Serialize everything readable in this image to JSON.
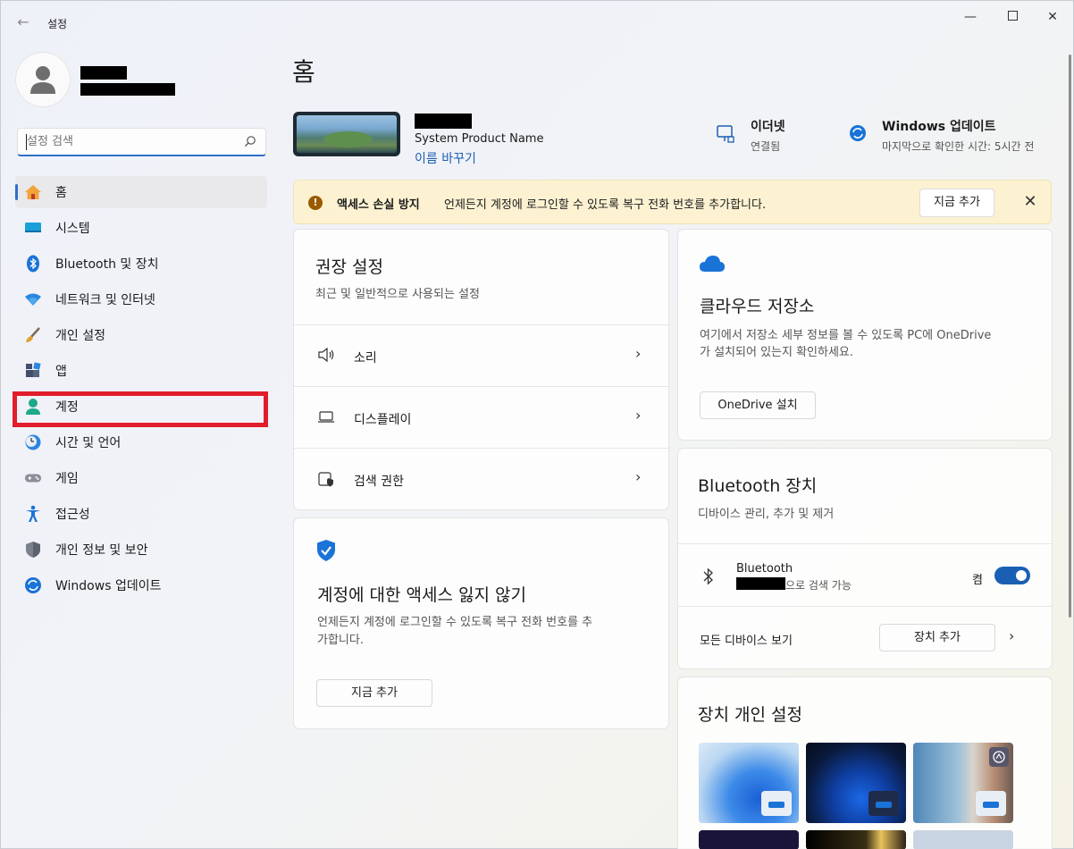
{
  "titlebar": {
    "app_title": "설정"
  },
  "search": {
    "placeholder": "설정 검색"
  },
  "nav": [
    {
      "label": "홈",
      "icon": "home-icon"
    },
    {
      "label": "시스템",
      "icon": "system-icon"
    },
    {
      "label": "Bluetooth 및 장치",
      "icon": "bluetooth-icon"
    },
    {
      "label": "네트워크 및 인터넷",
      "icon": "wifi-icon"
    },
    {
      "label": "개인 설정",
      "icon": "brush-icon"
    },
    {
      "label": "앱",
      "icon": "apps-icon"
    },
    {
      "label": "계정",
      "icon": "account-icon"
    },
    {
      "label": "시간 및 언어",
      "icon": "clock-globe-icon"
    },
    {
      "label": "게임",
      "icon": "gamepad-icon"
    },
    {
      "label": "접근성",
      "icon": "accessibility-icon"
    },
    {
      "label": "개인 정보 및 보안",
      "icon": "shield-icon"
    },
    {
      "label": "Windows 업데이트",
      "icon": "update-icon"
    }
  ],
  "main": {
    "title": "홈",
    "device": {
      "model": "System Product Name",
      "rename": "이름 바꾸기"
    },
    "status": [
      {
        "title": "이더넷",
        "sub": "연결됨"
      },
      {
        "title": "Windows 업데이트",
        "sub": "마지막으로 확인한 시간: 5시간 전"
      }
    ],
    "banner": {
      "title": "액세스 손실 방지",
      "text": "언제든지 계정에 로그인할 수 있도록 복구 전화 번호를 추가합니다.",
      "button": "지금 추가"
    },
    "recommended": {
      "title": "권장 설정",
      "sub": "최근 및 일반적으로 사용되는 설정",
      "items": [
        "소리",
        "디스플레이",
        "검색 권한"
      ]
    },
    "account_card": {
      "title": "계정에 대한 액세스 잃지 않기",
      "text_line1": "언제든지 계정에 로그인할 수 있도록 복구 전화 번호를 추",
      "text_line2": "가합니다.",
      "button": "지금 추가"
    },
    "cloud_card": {
      "title": "클라우드 저장소",
      "text_line1": "여기에서 저장소 세부 정보를 볼 수 있도록 PC에 OneDrive",
      "text_line2": "가 설치되어 있는지 확인하세요.",
      "button": "OneDrive 설치"
    },
    "bluetooth_card": {
      "title": "Bluetooth 장치",
      "sub": "디바이스 관리, 추가 및 제거",
      "bt_label": "Bluetooth",
      "bt_discoverable_suffix": "으로 검색 가능",
      "toggle_label": "켬",
      "toggle_on": true,
      "all_devices": "모든 디바이스 보기",
      "add_device": "장치 추가"
    },
    "personalize_card": {
      "title": "장치 개인 설정"
    }
  },
  "colors": {
    "accent": "#1a5fb4",
    "highlight": "#e11d2b",
    "banner_bg": "#fcf2d2"
  }
}
